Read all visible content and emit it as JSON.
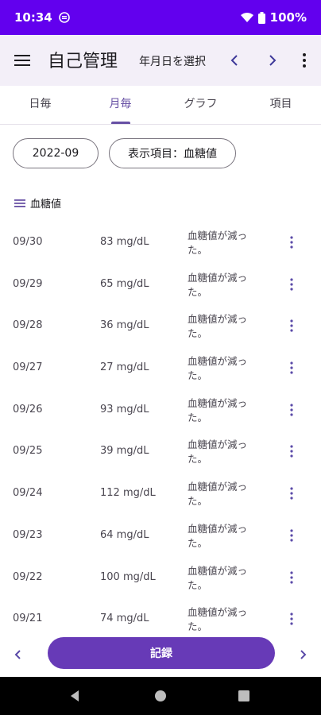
{
  "status_bar": {
    "time": "10:34",
    "battery": "100%"
  },
  "app_bar": {
    "title": "自己管理",
    "date_select": "年月日を選択"
  },
  "tabs": [
    {
      "label": "日毎",
      "active": false
    },
    {
      "label": "月毎",
      "active": true
    },
    {
      "label": "グラフ",
      "active": false
    },
    {
      "label": "項目",
      "active": false
    }
  ],
  "filters": {
    "month": "2022-09",
    "display_item": "表示項目：血糖値"
  },
  "section": {
    "title": "血糖値"
  },
  "rows": [
    {
      "date": "09/30",
      "value": "83 mg/dL",
      "memo": "血糖値が減った。"
    },
    {
      "date": "09/29",
      "value": "65 mg/dL",
      "memo": "血糖値が減った。"
    },
    {
      "date": "09/28",
      "value": "36 mg/dL",
      "memo": "血糖値が減った。"
    },
    {
      "date": "09/27",
      "value": "27 mg/dL",
      "memo": "血糖値が減った。"
    },
    {
      "date": "09/26",
      "value": "93 mg/dL",
      "memo": "血糖値が減った。"
    },
    {
      "date": "09/25",
      "value": "39 mg/dL",
      "memo": "血糖値が減った。"
    },
    {
      "date": "09/24",
      "value": "112 mg/dL",
      "memo": "血糖値が減った。"
    },
    {
      "date": "09/23",
      "value": "64 mg/dL",
      "memo": "血糖値が減った。"
    },
    {
      "date": "09/22",
      "value": "100 mg/dL",
      "memo": "血糖値が減った。"
    },
    {
      "date": "09/21",
      "value": "74 mg/dL",
      "memo": "血糖値が減った。"
    }
  ],
  "bottom": {
    "record_label": "記録"
  },
  "colors": {
    "status_bar": "#6200ee",
    "accent": "#6750a4",
    "record_button": "#673ab7",
    "app_bar": "#f3eff8"
  }
}
